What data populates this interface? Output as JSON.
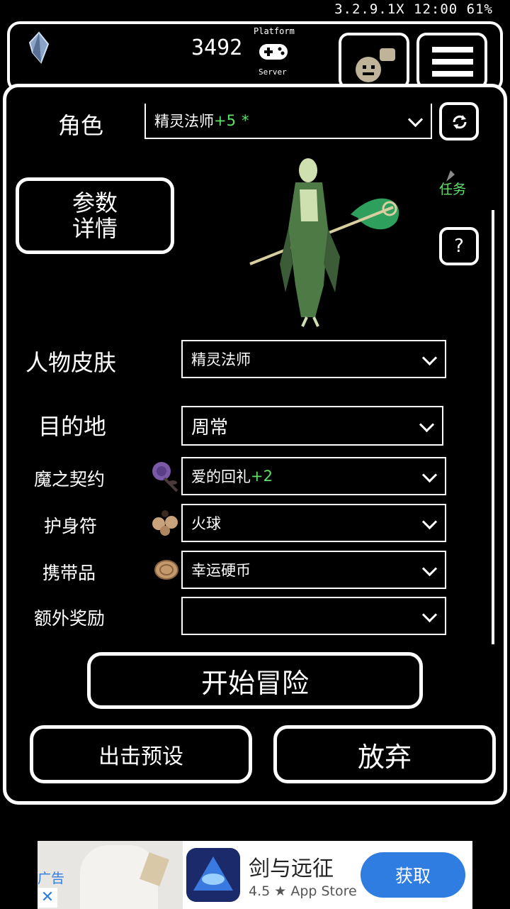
{
  "status_bar": {
    "text": "3.2.9.1X 12:00 61%"
  },
  "header": {
    "gold_count": "3492",
    "platform_label": "Platform",
    "server_label": "Server"
  },
  "character": {
    "label": "角色",
    "selected_name": "精灵法师",
    "selected_bonus": "+5",
    "selected_star": "*"
  },
  "params_button": {
    "line1": "参数",
    "line2": "详情"
  },
  "task_label": "任务",
  "help_label": "?",
  "skin": {
    "label": "人物皮肤",
    "value": "精灵法师"
  },
  "destination": {
    "label": "目的地",
    "value": "周常"
  },
  "contract": {
    "label": "魔之契约",
    "value": "爱的回礼",
    "bonus": "+2"
  },
  "amulet": {
    "label": "护身符",
    "value": "火球"
  },
  "carry": {
    "label": "携带品",
    "value": "幸运硬币"
  },
  "extra_reward": {
    "label": "额外奖励",
    "value": ""
  },
  "start_button": "开始冒险",
  "preset_button": "出击预设",
  "abandon_button": "放弃",
  "ad": {
    "tag": "广告",
    "close": "✕",
    "title": "剑与远征",
    "rating": "4.5 ★ App Store",
    "cta": "获取"
  },
  "colors": {
    "accent_green": "#5fe06a",
    "ad_button": "#2f7de1"
  }
}
